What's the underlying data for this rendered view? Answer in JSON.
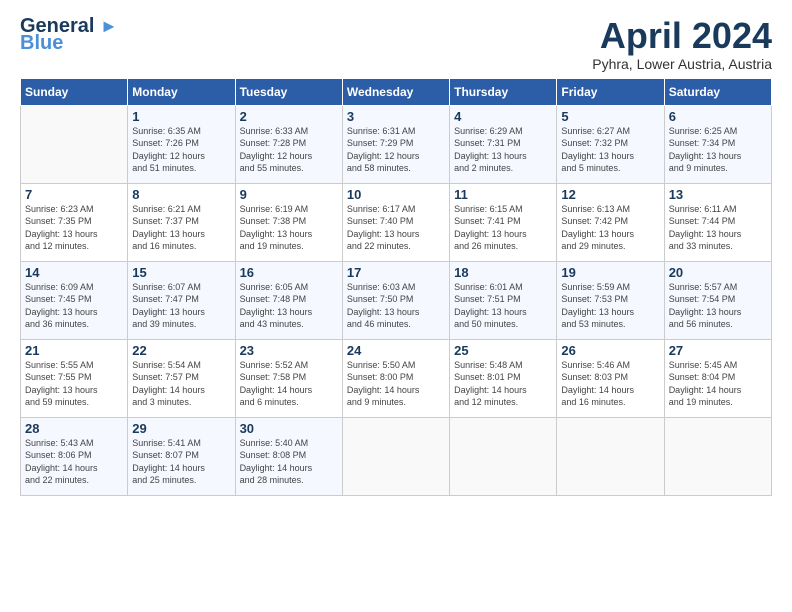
{
  "header": {
    "logo_line1": "General",
    "logo_line2": "Blue",
    "month": "April 2024",
    "location": "Pyhra, Lower Austria, Austria"
  },
  "weekdays": [
    "Sunday",
    "Monday",
    "Tuesday",
    "Wednesday",
    "Thursday",
    "Friday",
    "Saturday"
  ],
  "weeks": [
    [
      {
        "day": "",
        "info": ""
      },
      {
        "day": "1",
        "info": "Sunrise: 6:35 AM\nSunset: 7:26 PM\nDaylight: 12 hours\nand 51 minutes."
      },
      {
        "day": "2",
        "info": "Sunrise: 6:33 AM\nSunset: 7:28 PM\nDaylight: 12 hours\nand 55 minutes."
      },
      {
        "day": "3",
        "info": "Sunrise: 6:31 AM\nSunset: 7:29 PM\nDaylight: 12 hours\nand 58 minutes."
      },
      {
        "day": "4",
        "info": "Sunrise: 6:29 AM\nSunset: 7:31 PM\nDaylight: 13 hours\nand 2 minutes."
      },
      {
        "day": "5",
        "info": "Sunrise: 6:27 AM\nSunset: 7:32 PM\nDaylight: 13 hours\nand 5 minutes."
      },
      {
        "day": "6",
        "info": "Sunrise: 6:25 AM\nSunset: 7:34 PM\nDaylight: 13 hours\nand 9 minutes."
      }
    ],
    [
      {
        "day": "7",
        "info": "Sunrise: 6:23 AM\nSunset: 7:35 PM\nDaylight: 13 hours\nand 12 minutes."
      },
      {
        "day": "8",
        "info": "Sunrise: 6:21 AM\nSunset: 7:37 PM\nDaylight: 13 hours\nand 16 minutes."
      },
      {
        "day": "9",
        "info": "Sunrise: 6:19 AM\nSunset: 7:38 PM\nDaylight: 13 hours\nand 19 minutes."
      },
      {
        "day": "10",
        "info": "Sunrise: 6:17 AM\nSunset: 7:40 PM\nDaylight: 13 hours\nand 22 minutes."
      },
      {
        "day": "11",
        "info": "Sunrise: 6:15 AM\nSunset: 7:41 PM\nDaylight: 13 hours\nand 26 minutes."
      },
      {
        "day": "12",
        "info": "Sunrise: 6:13 AM\nSunset: 7:42 PM\nDaylight: 13 hours\nand 29 minutes."
      },
      {
        "day": "13",
        "info": "Sunrise: 6:11 AM\nSunset: 7:44 PM\nDaylight: 13 hours\nand 33 minutes."
      }
    ],
    [
      {
        "day": "14",
        "info": "Sunrise: 6:09 AM\nSunset: 7:45 PM\nDaylight: 13 hours\nand 36 minutes."
      },
      {
        "day": "15",
        "info": "Sunrise: 6:07 AM\nSunset: 7:47 PM\nDaylight: 13 hours\nand 39 minutes."
      },
      {
        "day": "16",
        "info": "Sunrise: 6:05 AM\nSunset: 7:48 PM\nDaylight: 13 hours\nand 43 minutes."
      },
      {
        "day": "17",
        "info": "Sunrise: 6:03 AM\nSunset: 7:50 PM\nDaylight: 13 hours\nand 46 minutes."
      },
      {
        "day": "18",
        "info": "Sunrise: 6:01 AM\nSunset: 7:51 PM\nDaylight: 13 hours\nand 50 minutes."
      },
      {
        "day": "19",
        "info": "Sunrise: 5:59 AM\nSunset: 7:53 PM\nDaylight: 13 hours\nand 53 minutes."
      },
      {
        "day": "20",
        "info": "Sunrise: 5:57 AM\nSunset: 7:54 PM\nDaylight: 13 hours\nand 56 minutes."
      }
    ],
    [
      {
        "day": "21",
        "info": "Sunrise: 5:55 AM\nSunset: 7:55 PM\nDaylight: 13 hours\nand 59 minutes."
      },
      {
        "day": "22",
        "info": "Sunrise: 5:54 AM\nSunset: 7:57 PM\nDaylight: 14 hours\nand 3 minutes."
      },
      {
        "day": "23",
        "info": "Sunrise: 5:52 AM\nSunset: 7:58 PM\nDaylight: 14 hours\nand 6 minutes."
      },
      {
        "day": "24",
        "info": "Sunrise: 5:50 AM\nSunset: 8:00 PM\nDaylight: 14 hours\nand 9 minutes."
      },
      {
        "day": "25",
        "info": "Sunrise: 5:48 AM\nSunset: 8:01 PM\nDaylight: 14 hours\nand 12 minutes."
      },
      {
        "day": "26",
        "info": "Sunrise: 5:46 AM\nSunset: 8:03 PM\nDaylight: 14 hours\nand 16 minutes."
      },
      {
        "day": "27",
        "info": "Sunrise: 5:45 AM\nSunset: 8:04 PM\nDaylight: 14 hours\nand 19 minutes."
      }
    ],
    [
      {
        "day": "28",
        "info": "Sunrise: 5:43 AM\nSunset: 8:06 PM\nDaylight: 14 hours\nand 22 minutes."
      },
      {
        "day": "29",
        "info": "Sunrise: 5:41 AM\nSunset: 8:07 PM\nDaylight: 14 hours\nand 25 minutes."
      },
      {
        "day": "30",
        "info": "Sunrise: 5:40 AM\nSunset: 8:08 PM\nDaylight: 14 hours\nand 28 minutes."
      },
      {
        "day": "",
        "info": ""
      },
      {
        "day": "",
        "info": ""
      },
      {
        "day": "",
        "info": ""
      },
      {
        "day": "",
        "info": ""
      }
    ]
  ]
}
